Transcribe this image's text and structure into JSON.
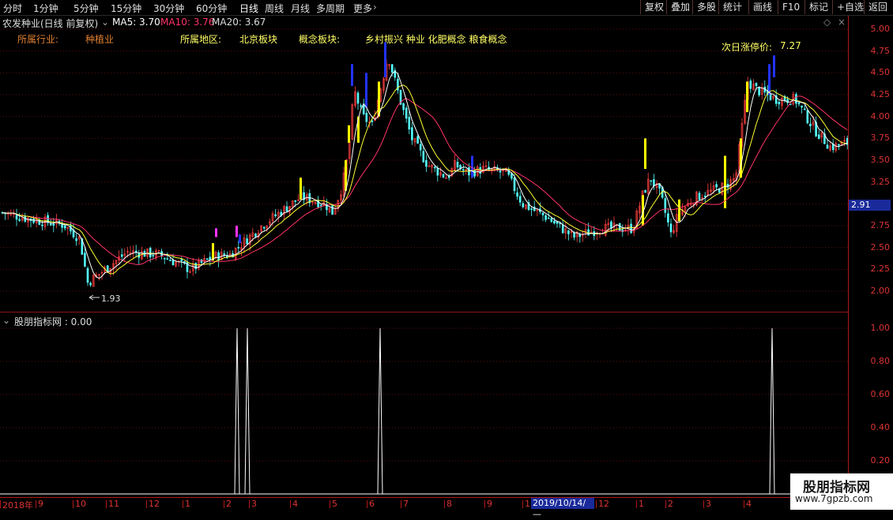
{
  "toolbar": {
    "tabs": [
      "分时",
      "1分钟",
      "5分钟",
      "15分钟",
      "30分钟",
      "60分钟",
      "日线",
      "周线",
      "月线",
      "多周期",
      "更多"
    ],
    "active_tab": "日线",
    "right_buttons": [
      "复权",
      "叠加",
      "多股",
      "统计",
      "画线",
      "F10",
      "标记",
      "+自选",
      "返回"
    ]
  },
  "title": {
    "name": "农发种业(日线 前复权)",
    "ma5": "MA5: 3.70",
    "ma10": "MA10: 3.76",
    "ma20": "MA20: 3.67"
  },
  "info": {
    "industry_label": "所属行业:",
    "industry_value": "种植业",
    "region_label": "所属地区:",
    "region_value": "北京板块",
    "concept_label": "概念板块:",
    "concept_value": "乡村振兴 种业 化肥概念 粮食概念",
    "limit_label": "次日涨停价:",
    "limit_value": "7.27"
  },
  "price_axis": [
    "5.00",
    "4.75",
    "4.50",
    "4.25",
    "4.00",
    "3.75",
    "3.50",
    "3.25",
    "3.00",
    "2.75",
    "2.50",
    "2.25",
    "2.00"
  ],
  "current_price_tag": "2.91",
  "low_marker": "1.93",
  "indicator": {
    "title": "股朋指标网 : 0.00",
    "axis": [
      "1.00",
      "0.80",
      "0.60",
      "0.40",
      "0.20"
    ]
  },
  "timeline": {
    "labels": [
      "2018年",
      "9",
      "10",
      "11",
      "12",
      "1",
      "2",
      "3",
      "4",
      "5",
      "6",
      "7",
      "8",
      "9",
      "1",
      "2019/10/14/—",
      "12",
      "1",
      "2",
      "3",
      "4"
    ],
    "highlight": "2019/10/14/—"
  },
  "watermark": {
    "line1": "股朋指标网",
    "line2": "www.7gpzb.com"
  },
  "colors": {
    "up": "#ff4040",
    "down": "#54ffff",
    "ma5": "#ffffff",
    "ma10": "#ffff33",
    "ma20": "#ff3366",
    "axis": "#d33333",
    "signal_yellow": "#ffff00",
    "signal_blue": "#2233ff",
    "signal_magenta": "#ff33ff"
  },
  "chart_data": {
    "type": "line",
    "indicator_spikes_y": [
      1.0,
      1.0,
      1.0,
      1.0
    ]
  }
}
